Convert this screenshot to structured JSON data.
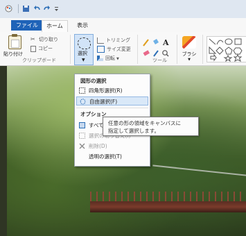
{
  "tabs": {
    "file": "ファイル",
    "home": "ホーム",
    "view": "表示"
  },
  "ribbon": {
    "paste_label": "貼り付け",
    "cut_label": "切り取り",
    "copy_label": "コピー",
    "clipboard_group": "クリップボード",
    "select_label": "選択",
    "crop_label": "トリミング",
    "resize_label": "サイズ変更",
    "rotate_label": "回転",
    "tools_group": "ツール",
    "brush_label": "ブラシ"
  },
  "select_menu": {
    "shape_header": "図形の選択",
    "options_header": "オプション",
    "items": [
      {
        "label": "四角形選択(R)",
        "state": "normal"
      },
      {
        "label": "自由選択(F)",
        "state": "highlighted"
      },
      {
        "label": "すべて選択(A)",
        "state": "normal"
      },
      {
        "label": "選択の切り替え(I)",
        "state": "disabled"
      },
      {
        "label": "削除(D)",
        "state": "disabled"
      },
      {
        "label": "透明の選択(T)",
        "state": "normal"
      }
    ]
  },
  "tooltip": {
    "line1": "任意の形の領域をキャンバスに",
    "line2": "指定して選択します。"
  },
  "colors": {
    "accent": "#1f63b8",
    "highlight": "#d9e8f8"
  }
}
